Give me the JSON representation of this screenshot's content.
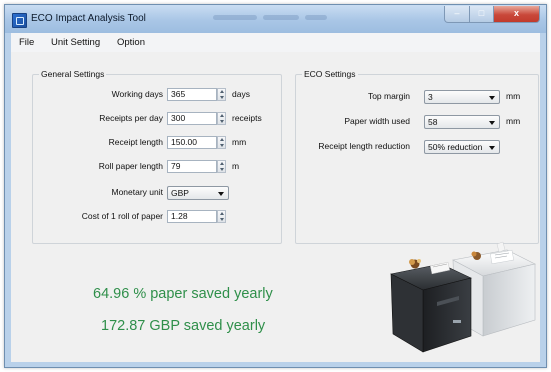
{
  "window": {
    "title": "ECO Impact Analysis Tool",
    "buttons": {
      "minimize": "–",
      "maximize": "□",
      "close": "x"
    }
  },
  "menu": {
    "items": [
      "File",
      "Unit Setting",
      "Option"
    ]
  },
  "general_settings": {
    "title": "General Settings",
    "rows": [
      {
        "label": "Working days",
        "value": "365",
        "unit": "days"
      },
      {
        "label": "Receipts per day",
        "value": "300",
        "unit": "receipts"
      },
      {
        "label": "Receipt length",
        "value": "150.00",
        "unit": "mm"
      },
      {
        "label": "Roll paper length",
        "value": "79",
        "unit": "m"
      }
    ],
    "monetary_unit": {
      "label": "Monetary unit",
      "value": "GBP"
    },
    "cost": {
      "label": "Cost of 1 roll of paper",
      "value": "1.28"
    }
  },
  "eco_settings": {
    "title": "ECO Settings",
    "top_margin": {
      "label": "Top margin",
      "value": "3",
      "unit": "mm"
    },
    "paper_width": {
      "label": "Paper width used",
      "value": "58",
      "unit": "mm"
    },
    "reduction": {
      "label": "Receipt length reduction",
      "value": "50% reduction"
    }
  },
  "results": {
    "paper_saved": "64.96 % paper saved yearly",
    "money_saved": "172.87 GBP saved yearly"
  },
  "colors": {
    "result_text": "#2f8f4a",
    "titlebar": "#a9c6e6",
    "client_background": "#f0f0f0"
  },
  "icons": {
    "app": "app-icon",
    "printers": "printer-illustration"
  }
}
